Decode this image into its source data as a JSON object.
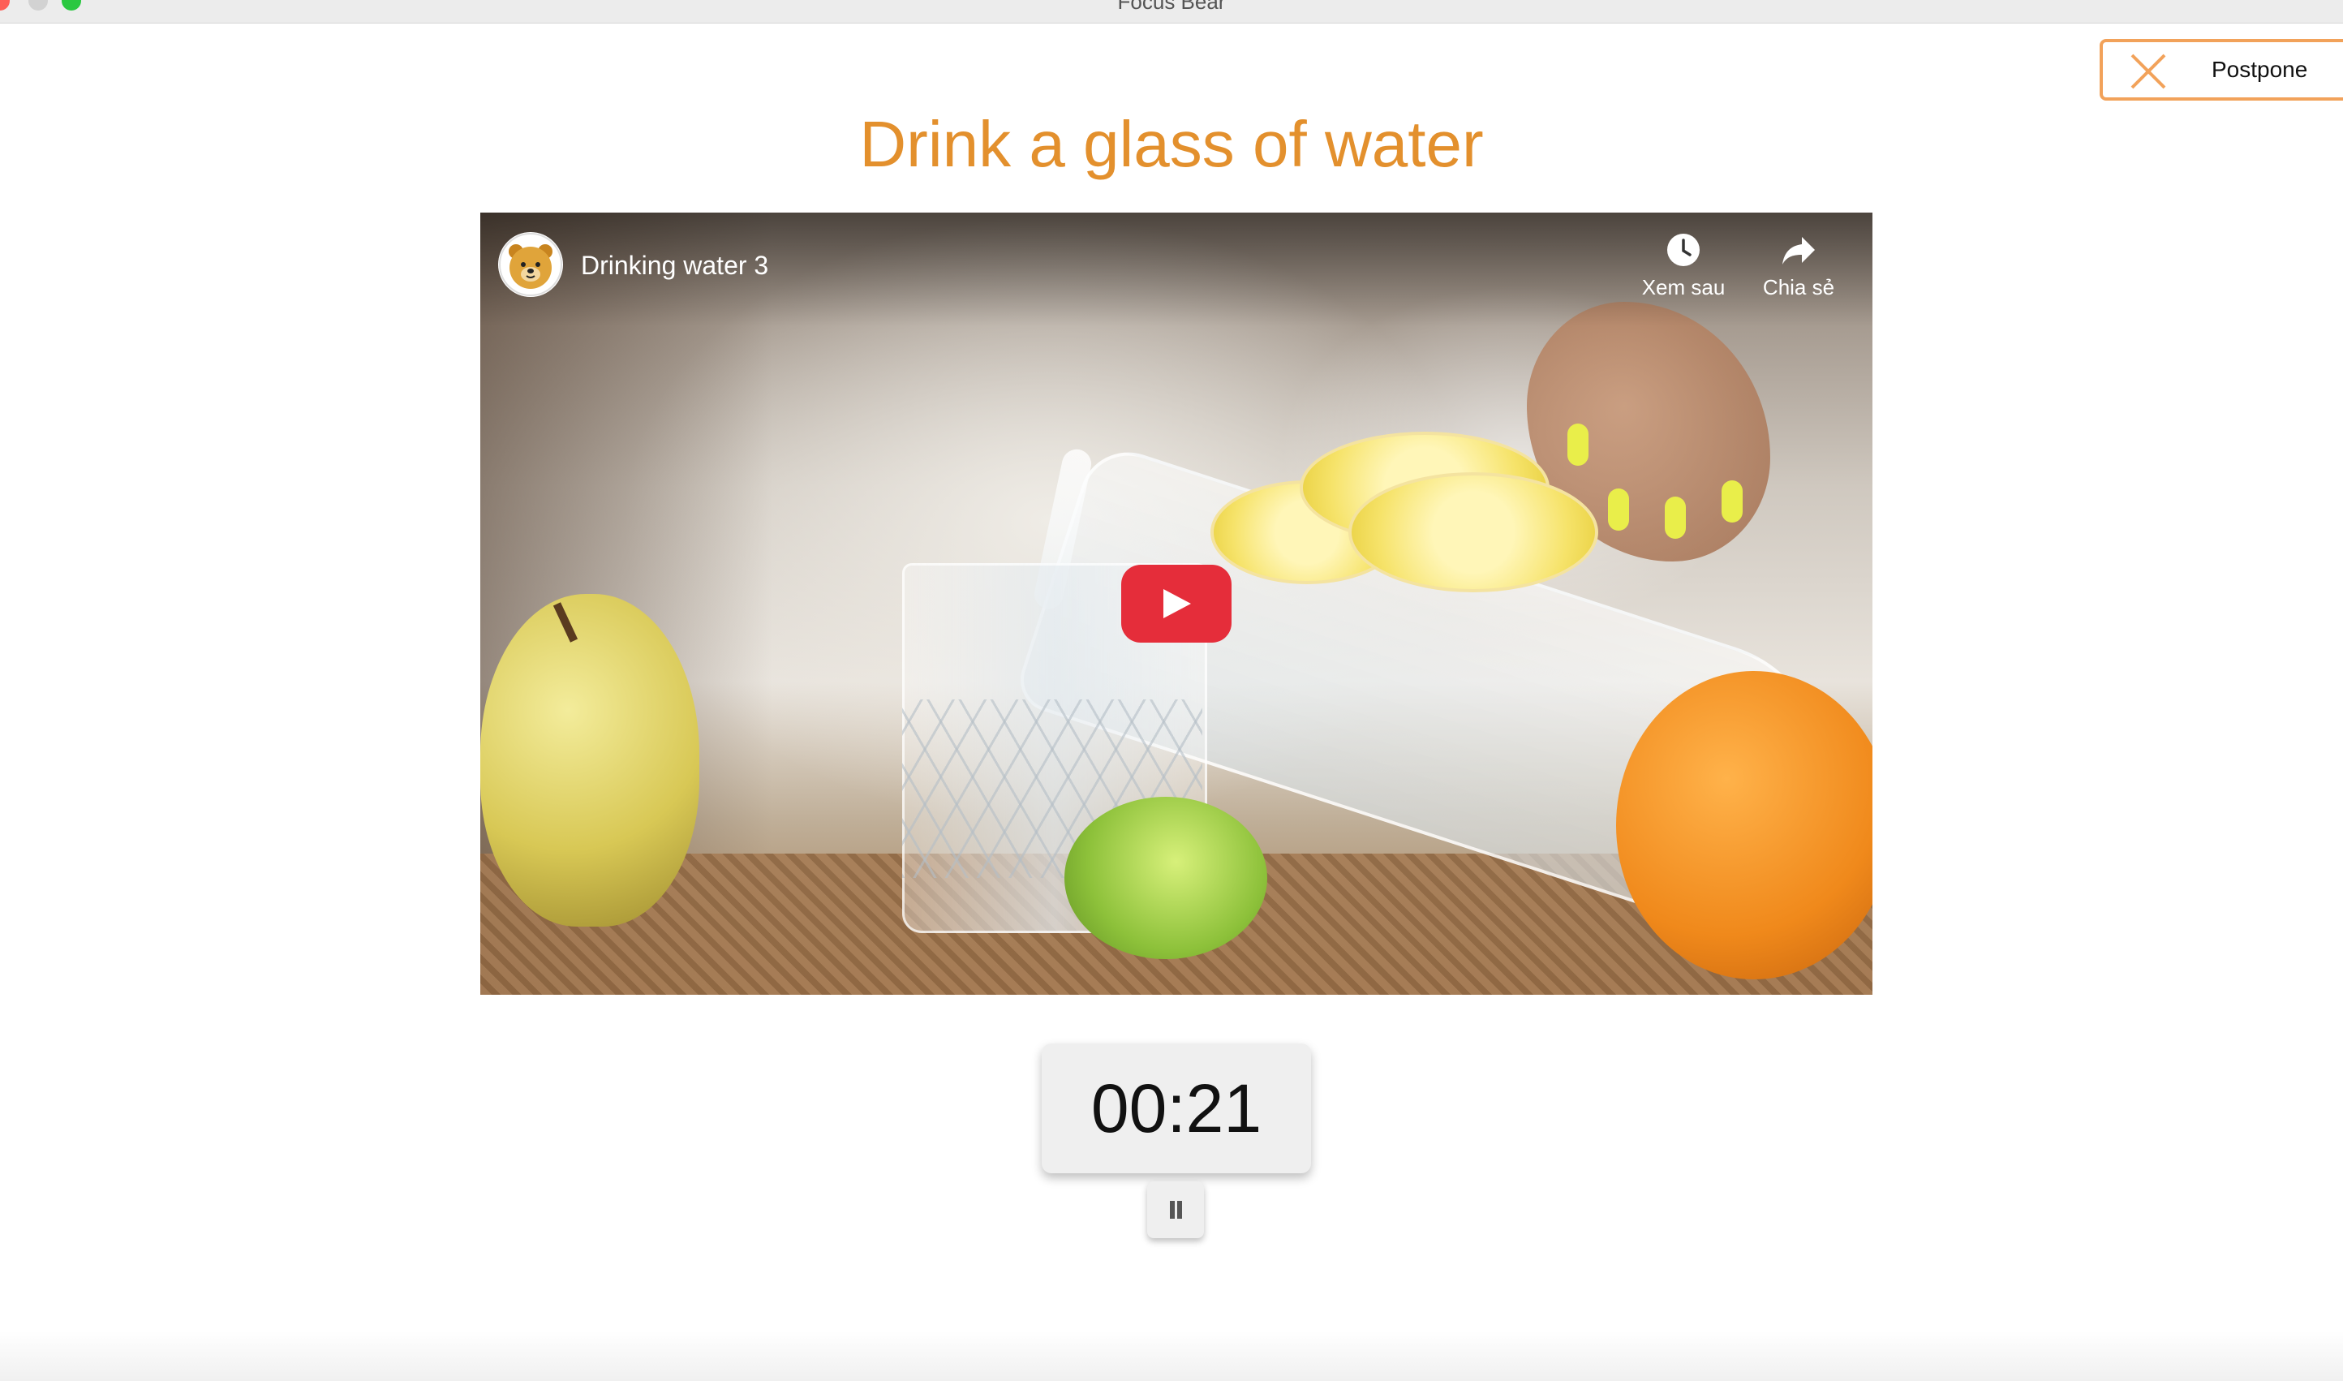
{
  "window": {
    "title": "Focus Bear"
  },
  "postpone": {
    "label": "Postpone",
    "icon": "close-icon",
    "accent": "#f2a25a"
  },
  "habit": {
    "title": "Drink a glass of water",
    "title_color": "#e3902d"
  },
  "video": {
    "title": "Drinking water 3",
    "channel_icon": "bear-logo-icon",
    "actions": [
      {
        "label": "Xem sau",
        "icon": "clock-icon"
      },
      {
        "label": "Chia sẻ",
        "icon": "share-icon"
      }
    ],
    "play_button_color": "#e52d3a"
  },
  "timer": {
    "value": "00:21"
  },
  "pause": {
    "icon": "pause-icon"
  }
}
